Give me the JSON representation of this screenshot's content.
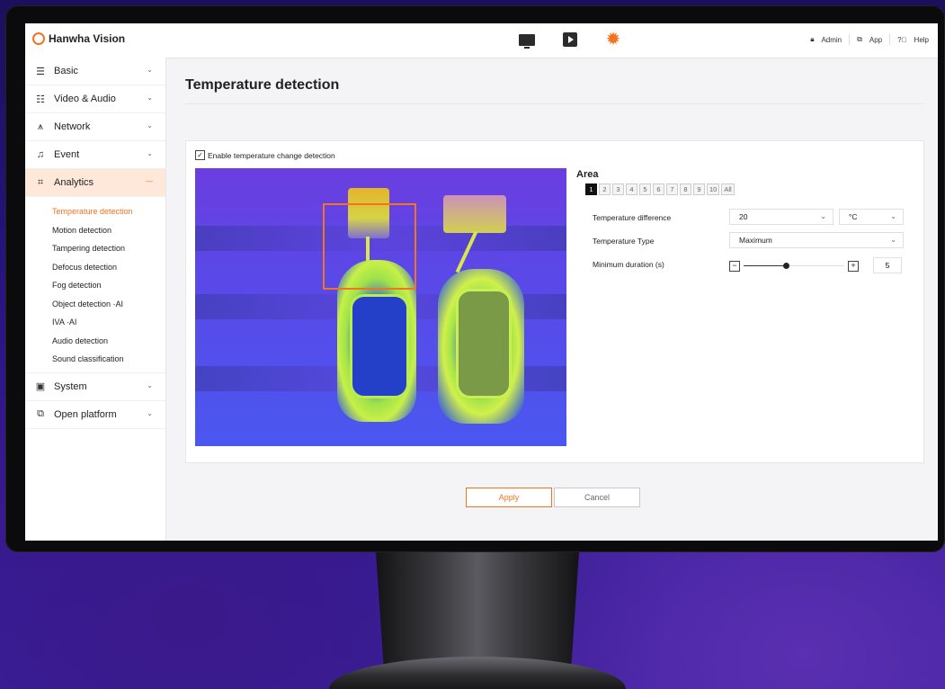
{
  "brand": {
    "name": "Hanwha Vision",
    "accent": "#f37321"
  },
  "topnav": {
    "icons": [
      "monitor-icon",
      "play-icon",
      "gear-icon"
    ],
    "admin_label": "Admin",
    "app_label": "App",
    "help_label": "Help"
  },
  "sidebar": {
    "items": [
      {
        "label": "Basic",
        "icon": "list-icon"
      },
      {
        "label": "Video & Audio",
        "icon": "sliders-icon"
      },
      {
        "label": "Network",
        "icon": "network-icon"
      },
      {
        "label": "Event",
        "icon": "bell-icon"
      },
      {
        "label": "Analytics",
        "icon": "analytics-icon",
        "expanded": true
      },
      {
        "label": "System",
        "icon": "system-icon"
      },
      {
        "label": "Open platform",
        "icon": "platform-icon"
      }
    ],
    "analytics_sub": [
      "Temperature detection",
      "Motion detection",
      "Tampering detection",
      "Defocus detection",
      "Fog detection",
      "Object detection ·AI",
      "IVA ·AI",
      "Audio detection",
      "Sound classification"
    ],
    "current_sub": "Temperature detection"
  },
  "main": {
    "title": "Temperature detection",
    "enable_label": "Enable temperature change detection",
    "enable_checked": true,
    "area": {
      "label": "Area",
      "tabs": [
        "1",
        "2",
        "3",
        "4",
        "5",
        "6",
        "7",
        "8",
        "9",
        "10",
        "All"
      ],
      "selected": "1"
    },
    "fields": {
      "temp_diff_label": "Temperature difference",
      "temp_diff_value": "20",
      "unit_value": "°C",
      "temp_type_label": "Temperature Type",
      "temp_type_value": "Maximum",
      "min_duration_label": "Minimum duration (s)",
      "min_duration_value": "5"
    },
    "apply_label": "Apply",
    "cancel_label": "Cancel"
  }
}
